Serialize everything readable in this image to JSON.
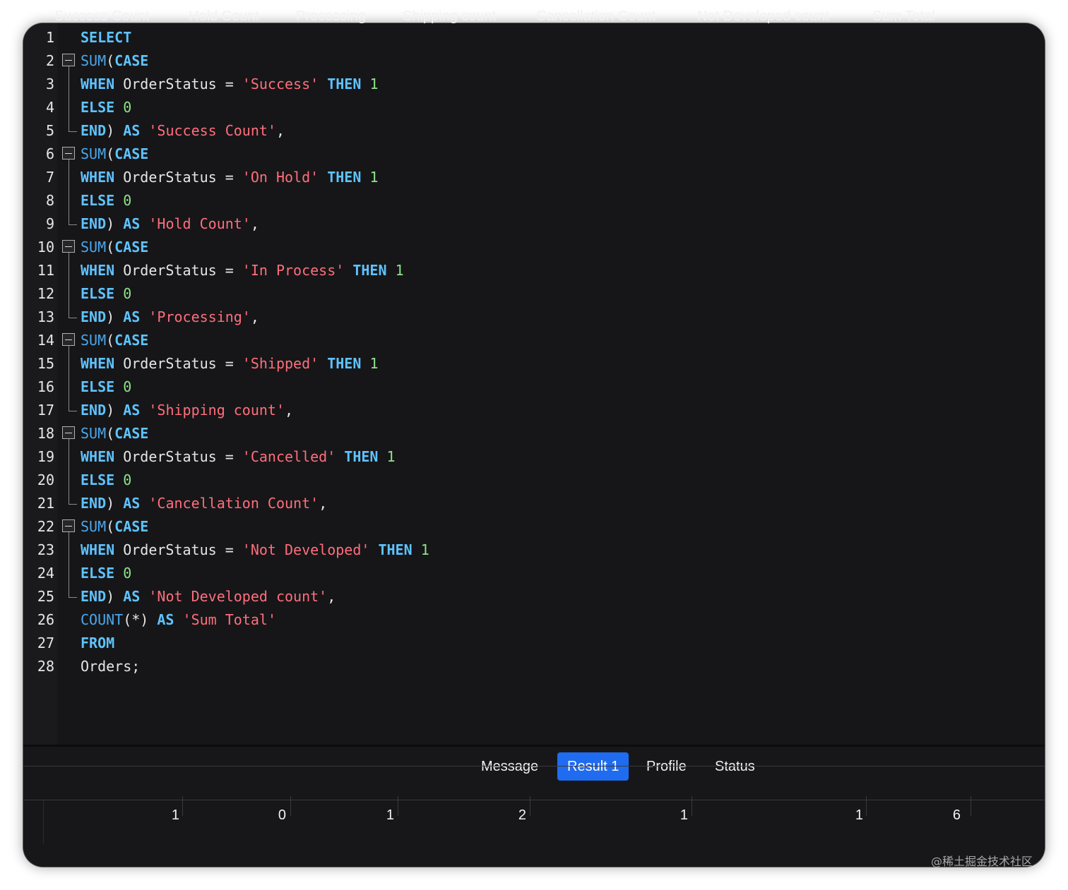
{
  "editor": {
    "lines": [
      [
        [
          "kw",
          "SELECT"
        ]
      ],
      [
        [
          "fn",
          "SUM"
        ],
        [
          "pl",
          "("
        ],
        [
          "kw",
          "CASE"
        ]
      ],
      [
        [
          "kw",
          "WHEN"
        ],
        [
          "pl",
          " OrderStatus = "
        ],
        [
          "str",
          "'Success'"
        ],
        [
          "pl",
          " "
        ],
        [
          "kw",
          "THEN"
        ],
        [
          "pl",
          " "
        ],
        [
          "num",
          "1"
        ]
      ],
      [
        [
          "kw",
          "ELSE"
        ],
        [
          "pl",
          " "
        ],
        [
          "num",
          "0"
        ]
      ],
      [
        [
          "kw",
          "END"
        ],
        [
          "pl",
          ") "
        ],
        [
          "kw",
          "AS"
        ],
        [
          "pl",
          " "
        ],
        [
          "str",
          "'Success Count'"
        ],
        [
          "pl",
          ","
        ]
      ],
      [
        [
          "fn",
          "SUM"
        ],
        [
          "pl",
          "("
        ],
        [
          "kw",
          "CASE"
        ]
      ],
      [
        [
          "kw",
          "WHEN"
        ],
        [
          "pl",
          " OrderStatus = "
        ],
        [
          "str",
          "'On Hold'"
        ],
        [
          "pl",
          " "
        ],
        [
          "kw",
          "THEN"
        ],
        [
          "pl",
          " "
        ],
        [
          "num",
          "1"
        ]
      ],
      [
        [
          "kw",
          "ELSE"
        ],
        [
          "pl",
          " "
        ],
        [
          "num",
          "0"
        ]
      ],
      [
        [
          "kw",
          "END"
        ],
        [
          "pl",
          ") "
        ],
        [
          "kw",
          "AS"
        ],
        [
          "pl",
          " "
        ],
        [
          "str",
          "'Hold Count'"
        ],
        [
          "pl",
          ","
        ]
      ],
      [
        [
          "fn",
          "SUM"
        ],
        [
          "pl",
          "("
        ],
        [
          "kw",
          "CASE"
        ]
      ],
      [
        [
          "kw",
          "WHEN"
        ],
        [
          "pl",
          " OrderStatus = "
        ],
        [
          "str",
          "'In Process'"
        ],
        [
          "pl",
          " "
        ],
        [
          "kw",
          "THEN"
        ],
        [
          "pl",
          " "
        ],
        [
          "num",
          "1"
        ]
      ],
      [
        [
          "kw",
          "ELSE"
        ],
        [
          "pl",
          " "
        ],
        [
          "num",
          "0"
        ]
      ],
      [
        [
          "kw",
          "END"
        ],
        [
          "pl",
          ") "
        ],
        [
          "kw",
          "AS"
        ],
        [
          "pl",
          " "
        ],
        [
          "str",
          "'Processing'"
        ],
        [
          "pl",
          ","
        ]
      ],
      [
        [
          "fn",
          "SUM"
        ],
        [
          "pl",
          "("
        ],
        [
          "kw",
          "CASE"
        ]
      ],
      [
        [
          "kw",
          "WHEN"
        ],
        [
          "pl",
          " OrderStatus = "
        ],
        [
          "str",
          "'Shipped'"
        ],
        [
          "pl",
          " "
        ],
        [
          "kw",
          "THEN"
        ],
        [
          "pl",
          " "
        ],
        [
          "num",
          "1"
        ]
      ],
      [
        [
          "kw",
          "ELSE"
        ],
        [
          "pl",
          " "
        ],
        [
          "num",
          "0"
        ]
      ],
      [
        [
          "kw",
          "END"
        ],
        [
          "pl",
          ") "
        ],
        [
          "kw",
          "AS"
        ],
        [
          "pl",
          " "
        ],
        [
          "str",
          "'Shipping count'"
        ],
        [
          "pl",
          ","
        ]
      ],
      [
        [
          "fn",
          "SUM"
        ],
        [
          "pl",
          "("
        ],
        [
          "kw",
          "CASE"
        ]
      ],
      [
        [
          "kw",
          "WHEN"
        ],
        [
          "pl",
          " OrderStatus = "
        ],
        [
          "str",
          "'Cancelled'"
        ],
        [
          "pl",
          " "
        ],
        [
          "kw",
          "THEN"
        ],
        [
          "pl",
          " "
        ],
        [
          "num",
          "1"
        ]
      ],
      [
        [
          "kw",
          "ELSE"
        ],
        [
          "pl",
          " "
        ],
        [
          "num",
          "0"
        ]
      ],
      [
        [
          "kw",
          "END"
        ],
        [
          "pl",
          ") "
        ],
        [
          "kw",
          "AS"
        ],
        [
          "pl",
          " "
        ],
        [
          "str",
          "'Cancellation Count'"
        ],
        [
          "pl",
          ","
        ]
      ],
      [
        [
          "fn",
          "SUM"
        ],
        [
          "pl",
          "("
        ],
        [
          "kw",
          "CASE"
        ]
      ],
      [
        [
          "kw",
          "WHEN"
        ],
        [
          "pl",
          " OrderStatus = "
        ],
        [
          "str",
          "'Not Developed'"
        ],
        [
          "pl",
          " "
        ],
        [
          "kw",
          "THEN"
        ],
        [
          "pl",
          " "
        ],
        [
          "num",
          "1"
        ]
      ],
      [
        [
          "kw",
          "ELSE"
        ],
        [
          "pl",
          " "
        ],
        [
          "num",
          "0"
        ]
      ],
      [
        [
          "kw",
          "END"
        ],
        [
          "pl",
          ") "
        ],
        [
          "kw",
          "AS"
        ],
        [
          "pl",
          " "
        ],
        [
          "str",
          "'Not Developed count'"
        ],
        [
          "pl",
          ","
        ]
      ],
      [
        [
          "fn",
          "COUNT"
        ],
        [
          "pl",
          "(*) "
        ],
        [
          "kw",
          "AS"
        ],
        [
          "pl",
          " "
        ],
        [
          "str",
          "'Sum Total'"
        ]
      ],
      [
        [
          "kw",
          "FROM"
        ]
      ],
      [
        [
          "pl",
          "Orders;"
        ]
      ]
    ],
    "colors": {
      "keyword": "#5fc3ff",
      "function": "#4aa7ec",
      "string": "#ff6e7c",
      "number": "#8fe38a",
      "plain": "#e6e6e6"
    }
  },
  "tabs": [
    {
      "label": "Message",
      "active": false
    },
    {
      "label": "Result 1",
      "active": true
    },
    {
      "label": "Profile",
      "active": false
    },
    {
      "label": "Status",
      "active": false
    }
  ],
  "results": {
    "columns": [
      "Success Count",
      "Hold Count",
      "Processing",
      "Shipping count",
      "Cancellation Count",
      "Not Developed count",
      "Sum Total"
    ],
    "rows": [
      [
        "1",
        "0",
        "1",
        "2",
        "1",
        "1",
        "6"
      ]
    ]
  },
  "accent_color": "#1f6cf0",
  "watermark": "@稀土掘金技术社区"
}
